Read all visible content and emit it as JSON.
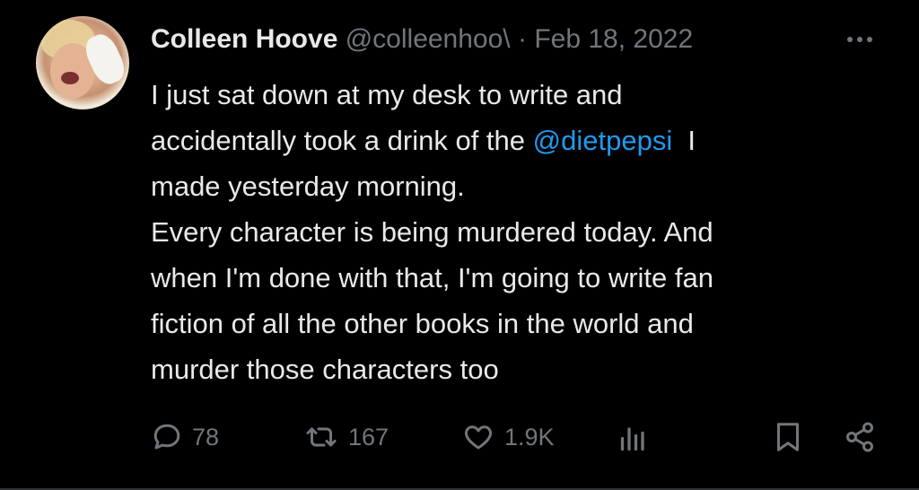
{
  "tweet": {
    "author_name": "Colleen Hoove",
    "handle": "@colleenhoo\\",
    "separator": "·",
    "date": "Feb 18, 2022",
    "line1": "I just sat down at my desk to write and",
    "line2_pre": "accidentally took a drink of the ",
    "mention": "@dietpepsi",
    "line2_post": "  I",
    "line3": "made yesterday morning.",
    "line4": "Every character is being murdered today. And",
    "line5": "when I'm done with that, I'm going to write fan",
    "line6": "fiction of all the other books in the world and",
    "line7": "murder those characters too"
  },
  "actions": {
    "replies": "78",
    "retweets": "167",
    "likes": "1.9K"
  },
  "icons": {
    "more": "more-horizontal-icon",
    "reply": "reply-icon",
    "retweet": "retweet-icon",
    "like": "heart-icon",
    "views": "views-icon",
    "bookmark": "bookmark-icon",
    "share": "share-icon"
  },
  "colors": {
    "background": "#000000",
    "text": "#e7e9ea",
    "muted": "#71767b",
    "link": "#1d9bf0"
  }
}
